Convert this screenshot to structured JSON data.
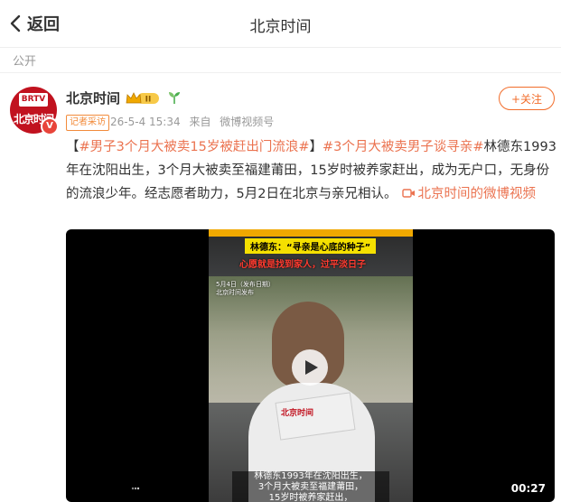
{
  "header": {
    "back_label": "返回",
    "title": "北京时间"
  },
  "visibility_label": "公开",
  "post": {
    "avatar": {
      "logo_small": "BRTV",
      "logo_text": "北京时间",
      "verified_mark": "V"
    },
    "user_name": "北京时间",
    "level_badge": "II",
    "follow_label": "+关注",
    "reporter_badge": "记者采访",
    "timestamp": "26-5-4 15:34",
    "source_prefix": "来自",
    "source": "微博视频号",
    "bracket_open": "【",
    "hashtag1": "#男子3个月大被卖15岁被赶出门流浪#",
    "bracket_close": "】",
    "hashtag2": "#3个月大被卖男子谈寻亲#",
    "body_text": "林德东1993年在沈阳出生，3个月大被卖至福建莆田，15岁时被养家赶出，成为无户口，无身份的流浪少年。经志愿者助力，5月2日在北京与亲兄相认。",
    "link_text": "北京时间的微博视频"
  },
  "video": {
    "caption_yellow": "林德东：“寻亲是心底的种子”",
    "caption_red": "心愿就是找到家人，过平淡日子",
    "date_note_1": "5月4日（发布日期）",
    "date_note_2": "北京时间发布",
    "card_text": "北京时间",
    "subtitle_1": "林德东1993年在沈阳出生，",
    "subtitle_2": "3个月大被卖至福建莆田，",
    "subtitle_3": "15岁时被养家赶出，",
    "duration": "00:27"
  },
  "colors": {
    "accent": "#eb7350",
    "brand_red": "#c1121f",
    "follow_orange": "#f26d2b"
  }
}
